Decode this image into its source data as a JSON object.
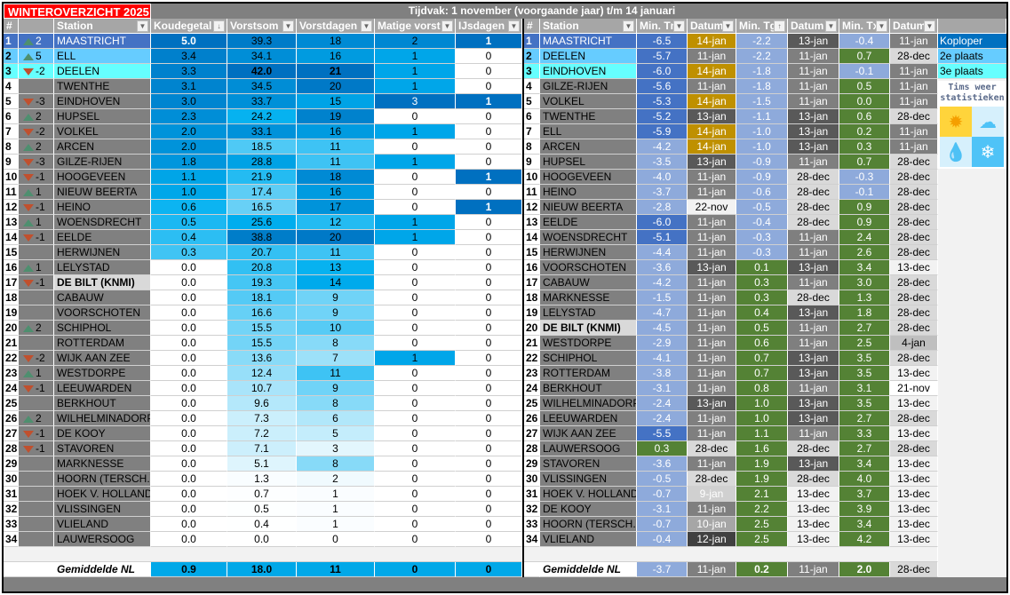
{
  "title": "WINTEROVERZICHT 2025",
  "period": "Tijdvak: 1 november (voorgaande jaar) t/m 14 januari",
  "left_headers": [
    "#",
    "",
    "Station",
    "Koudegetal",
    "Vorstsom",
    "Vorstdagen",
    "Matige vorst",
    "IJsdagen"
  ],
  "right_headers": [
    "#",
    "Station",
    "Min. Tn",
    "Datum",
    "Min. Tg",
    "Datum",
    "Min. Tx",
    "Datum"
  ],
  "sort_icons": {
    "koudegetal": "↓",
    "min_tg": "↑"
  },
  "left_rows": [
    [
      "1",
      "up",
      "2",
      "MAASTRICHT",
      "5.0",
      "39.3",
      "18",
      "2",
      "1"
    ],
    [
      "2",
      "up",
      "5",
      "ELL",
      "3.4",
      "34.1",
      "16",
      "1",
      "0"
    ],
    [
      "3",
      "down",
      "-2",
      "DEELEN",
      "3.3",
      "42.0",
      "21",
      "1",
      "0"
    ],
    [
      "4",
      "",
      "",
      "TWENTHE",
      "3.1",
      "34.5",
      "20",
      "1",
      "0"
    ],
    [
      "5",
      "down",
      "-3",
      "EINDHOVEN",
      "3.0",
      "33.7",
      "15",
      "3",
      "1"
    ],
    [
      "6",
      "up",
      "2",
      "HUPSEL",
      "2.3",
      "24.2",
      "19",
      "0",
      "0"
    ],
    [
      "7",
      "down",
      "-2",
      "VOLKEL",
      "2.0",
      "33.1",
      "16",
      "1",
      "0"
    ],
    [
      "8",
      "up",
      "2",
      "ARCEN",
      "2.0",
      "18.5",
      "11",
      "0",
      "0"
    ],
    [
      "9",
      "down",
      "-3",
      "GILZE-RIJEN",
      "1.8",
      "28.8",
      "11",
      "1",
      "0"
    ],
    [
      "10",
      "down",
      "-1",
      "HOOGEVEEN",
      "1.1",
      "21.9",
      "18",
      "0",
      "1"
    ],
    [
      "11",
      "up",
      "1",
      "NIEUW BEERTA",
      "1.0",
      "17.4",
      "16",
      "0",
      "0"
    ],
    [
      "12",
      "down",
      "-1",
      "HEINO",
      "0.6",
      "16.5",
      "17",
      "0",
      "1"
    ],
    [
      "13",
      "up",
      "1",
      "WOENSDRECHT",
      "0.5",
      "25.6",
      "12",
      "1",
      "0"
    ],
    [
      "14",
      "down",
      "-1",
      "EELDE",
      "0.4",
      "38.8",
      "20",
      "1",
      "0"
    ],
    [
      "15",
      "",
      "",
      "HERWIJNEN",
      "0.3",
      "20.7",
      "11",
      "0",
      "0"
    ],
    [
      "16",
      "up",
      "1",
      "LELYSTAD",
      "0.0",
      "20.8",
      "13",
      "0",
      "0"
    ],
    [
      "17",
      "down",
      "-1",
      "DE BILT (KNMI)",
      "0.0",
      "19.3",
      "14",
      "0",
      "0"
    ],
    [
      "18",
      "",
      "",
      "CABAUW",
      "0.0",
      "18.1",
      "9",
      "0",
      "0"
    ],
    [
      "19",
      "",
      "",
      "VOORSCHOTEN",
      "0.0",
      "16.6",
      "9",
      "0",
      "0"
    ],
    [
      "20",
      "up",
      "2",
      "SCHIPHOL",
      "0.0",
      "15.5",
      "10",
      "0",
      "0"
    ],
    [
      "21",
      "",
      "",
      "ROTTERDAM",
      "0.0",
      "15.5",
      "8",
      "0",
      "0"
    ],
    [
      "22",
      "down",
      "-2",
      "WIJK AAN ZEE",
      "0.0",
      "13.6",
      "7",
      "1",
      "0"
    ],
    [
      "23",
      "up",
      "1",
      "WESTDORPE",
      "0.0",
      "12.4",
      "11",
      "0",
      "0"
    ],
    [
      "24",
      "down",
      "-1",
      "LEEUWARDEN",
      "0.0",
      "10.7",
      "9",
      "0",
      "0"
    ],
    [
      "25",
      "",
      "",
      "BERKHOUT",
      "0.0",
      "9.6",
      "8",
      "0",
      "0"
    ],
    [
      "26",
      "up",
      "2",
      "WILHELMINADORP",
      "0.0",
      "7.3",
      "6",
      "0",
      "0"
    ],
    [
      "27",
      "down",
      "-1",
      "DE KOOY",
      "0.0",
      "7.2",
      "5",
      "0",
      "0"
    ],
    [
      "28",
      "down",
      "-1",
      "STAVOREN",
      "0.0",
      "7.1",
      "3",
      "0",
      "0"
    ],
    [
      "29",
      "",
      "",
      "MARKNESSE",
      "0.0",
      "5.1",
      "8",
      "0",
      "0"
    ],
    [
      "30",
      "",
      "",
      "HOORN (TERSCH.)",
      "0.0",
      "1.3",
      "2",
      "0",
      "0"
    ],
    [
      "31",
      "",
      "",
      "HOEK V. HOLLAND",
      "0.0",
      "0.7",
      "1",
      "0",
      "0"
    ],
    [
      "32",
      "",
      "",
      "VLISSINGEN",
      "0.0",
      "0.5",
      "1",
      "0",
      "0"
    ],
    [
      "33",
      "",
      "",
      "VLIELAND",
      "0.0",
      "0.4",
      "1",
      "0",
      "0"
    ],
    [
      "34",
      "",
      "",
      "LAUWERSOOG",
      "0.0",
      "0.0",
      "0",
      "0",
      "0"
    ]
  ],
  "left_avg": [
    "Gemiddelde NL",
    "0.9",
    "18.0",
    "11",
    "0",
    "0"
  ],
  "right_rows": [
    [
      "1",
      "MAASTRICHT",
      "-6.5",
      "14-jan",
      "-2.2",
      "13-jan",
      "-0.4",
      "11-jan"
    ],
    [
      "2",
      "DEELEN",
      "-5.7",
      "11-jan",
      "-2.2",
      "11-jan",
      "0.7",
      "28-dec"
    ],
    [
      "3",
      "EINDHOVEN",
      "-6.0",
      "14-jan",
      "-1.8",
      "11-jan",
      "-0.1",
      "11-jan"
    ],
    [
      "4",
      "GILZE-RIJEN",
      "-5.6",
      "11-jan",
      "-1.8",
      "11-jan",
      "0.5",
      "11-jan"
    ],
    [
      "5",
      "VOLKEL",
      "-5.3",
      "14-jan",
      "-1.5",
      "11-jan",
      "0.0",
      "11-jan"
    ],
    [
      "6",
      "TWENTHE",
      "-5.2",
      "13-jan",
      "-1.1",
      "13-jan",
      "0.6",
      "28-dec"
    ],
    [
      "7",
      "ELL",
      "-5.9",
      "14-jan",
      "-1.0",
      "13-jan",
      "0.2",
      "11-jan"
    ],
    [
      "8",
      "ARCEN",
      "-4.2",
      "14-jan",
      "-1.0",
      "13-jan",
      "0.3",
      "11-jan"
    ],
    [
      "9",
      "HUPSEL",
      "-3.5",
      "13-jan",
      "-0.9",
      "11-jan",
      "0.7",
      "28-dec"
    ],
    [
      "10",
      "HOOGEVEEN",
      "-4.0",
      "11-jan",
      "-0.9",
      "28-dec",
      "-0.3",
      "28-dec"
    ],
    [
      "11",
      "HEINO",
      "-3.7",
      "11-jan",
      "-0.6",
      "28-dec",
      "-0.1",
      "28-dec"
    ],
    [
      "12",
      "NIEUW BEERTA",
      "-2.8",
      "22-nov",
      "-0.5",
      "28-dec",
      "0.9",
      "28-dec"
    ],
    [
      "13",
      "EELDE",
      "-6.0",
      "11-jan",
      "-0.4",
      "28-dec",
      "0.9",
      "28-dec"
    ],
    [
      "14",
      "WOENSDRECHT",
      "-5.1",
      "11-jan",
      "-0.3",
      "11-jan",
      "2.4",
      "28-dec"
    ],
    [
      "15",
      "HERWIJNEN",
      "-4.4",
      "11-jan",
      "-0.3",
      "11-jan",
      "2.6",
      "28-dec"
    ],
    [
      "16",
      "VOORSCHOTEN",
      "-3.6",
      "13-jan",
      "0.1",
      "13-jan",
      "3.4",
      "13-dec"
    ],
    [
      "17",
      "CABAUW",
      "-4.2",
      "11-jan",
      "0.3",
      "11-jan",
      "3.0",
      "28-dec"
    ],
    [
      "18",
      "MARKNESSE",
      "-1.5",
      "11-jan",
      "0.3",
      "28-dec",
      "1.3",
      "28-dec"
    ],
    [
      "19",
      "LELYSTAD",
      "-4.7",
      "11-jan",
      "0.4",
      "13-jan",
      "1.8",
      "28-dec"
    ],
    [
      "20",
      "DE BILT (KNMI)",
      "-4.5",
      "11-jan",
      "0.5",
      "11-jan",
      "2.7",
      "28-dec"
    ],
    [
      "21",
      "WESTDORPE",
      "-2.9",
      "11-jan",
      "0.6",
      "11-jan",
      "2.5",
      "4-jan"
    ],
    [
      "22",
      "SCHIPHOL",
      "-4.1",
      "11-jan",
      "0.7",
      "13-jan",
      "3.5",
      "28-dec"
    ],
    [
      "23",
      "ROTTERDAM",
      "-3.8",
      "11-jan",
      "0.7",
      "13-jan",
      "3.5",
      "13-dec"
    ],
    [
      "24",
      "BERKHOUT",
      "-3.1",
      "11-jan",
      "0.8",
      "11-jan",
      "3.1",
      "21-nov"
    ],
    [
      "25",
      "WILHELMINADORP",
      "-2.4",
      "13-jan",
      "1.0",
      "13-jan",
      "3.5",
      "13-dec"
    ],
    [
      "26",
      "LEEUWARDEN",
      "-2.4",
      "11-jan",
      "1.0",
      "13-jan",
      "2.7",
      "28-dec"
    ],
    [
      "27",
      "WIJK AAN ZEE",
      "-5.5",
      "11-jan",
      "1.1",
      "11-jan",
      "3.3",
      "13-dec"
    ],
    [
      "28",
      "LAUWERSOOG",
      "0.3",
      "28-dec",
      "1.6",
      "28-dec",
      "2.7",
      "28-dec"
    ],
    [
      "29",
      "STAVOREN",
      "-3.6",
      "11-jan",
      "1.9",
      "13-jan",
      "3.4",
      "13-dec"
    ],
    [
      "30",
      "VLISSINGEN",
      "-0.5",
      "28-dec",
      "1.9",
      "28-dec",
      "4.0",
      "13-dec"
    ],
    [
      "31",
      "HOEK V. HOLLAND",
      "-0.7",
      "9-jan",
      "2.1",
      "13-dec",
      "3.7",
      "13-dec"
    ],
    [
      "32",
      "DE KOOY",
      "-3.1",
      "11-jan",
      "2.2",
      "13-dec",
      "3.9",
      "13-dec"
    ],
    [
      "33",
      "HOORN (TERSCH.)",
      "-0.7",
      "10-jan",
      "2.5",
      "13-dec",
      "3.4",
      "13-dec"
    ],
    [
      "34",
      "VLIELAND",
      "-0.4",
      "12-jan",
      "2.5",
      "13-dec",
      "4.2",
      "13-dec"
    ]
  ],
  "right_avg": [
    "Gemiddelde NL",
    "-3.7",
    "11-jan",
    "0.2",
    "11-jan",
    "2.0",
    "28-dec"
  ],
  "legend": {
    "first": "Koploper",
    "second": "2e plaats",
    "third": "3e plaats"
  },
  "logo": {
    "line1": "Tims weer",
    "line2": "statistieken"
  },
  "colors": {
    "first": "#4472c4",
    "koploper": "#0070c0",
    "second": "#66ccff",
    "third": "#66ffff",
    "cold": "#4472c4",
    "coolish": "#8eaadb",
    "mild": "#548235",
    "title": "#ff0000"
  }
}
